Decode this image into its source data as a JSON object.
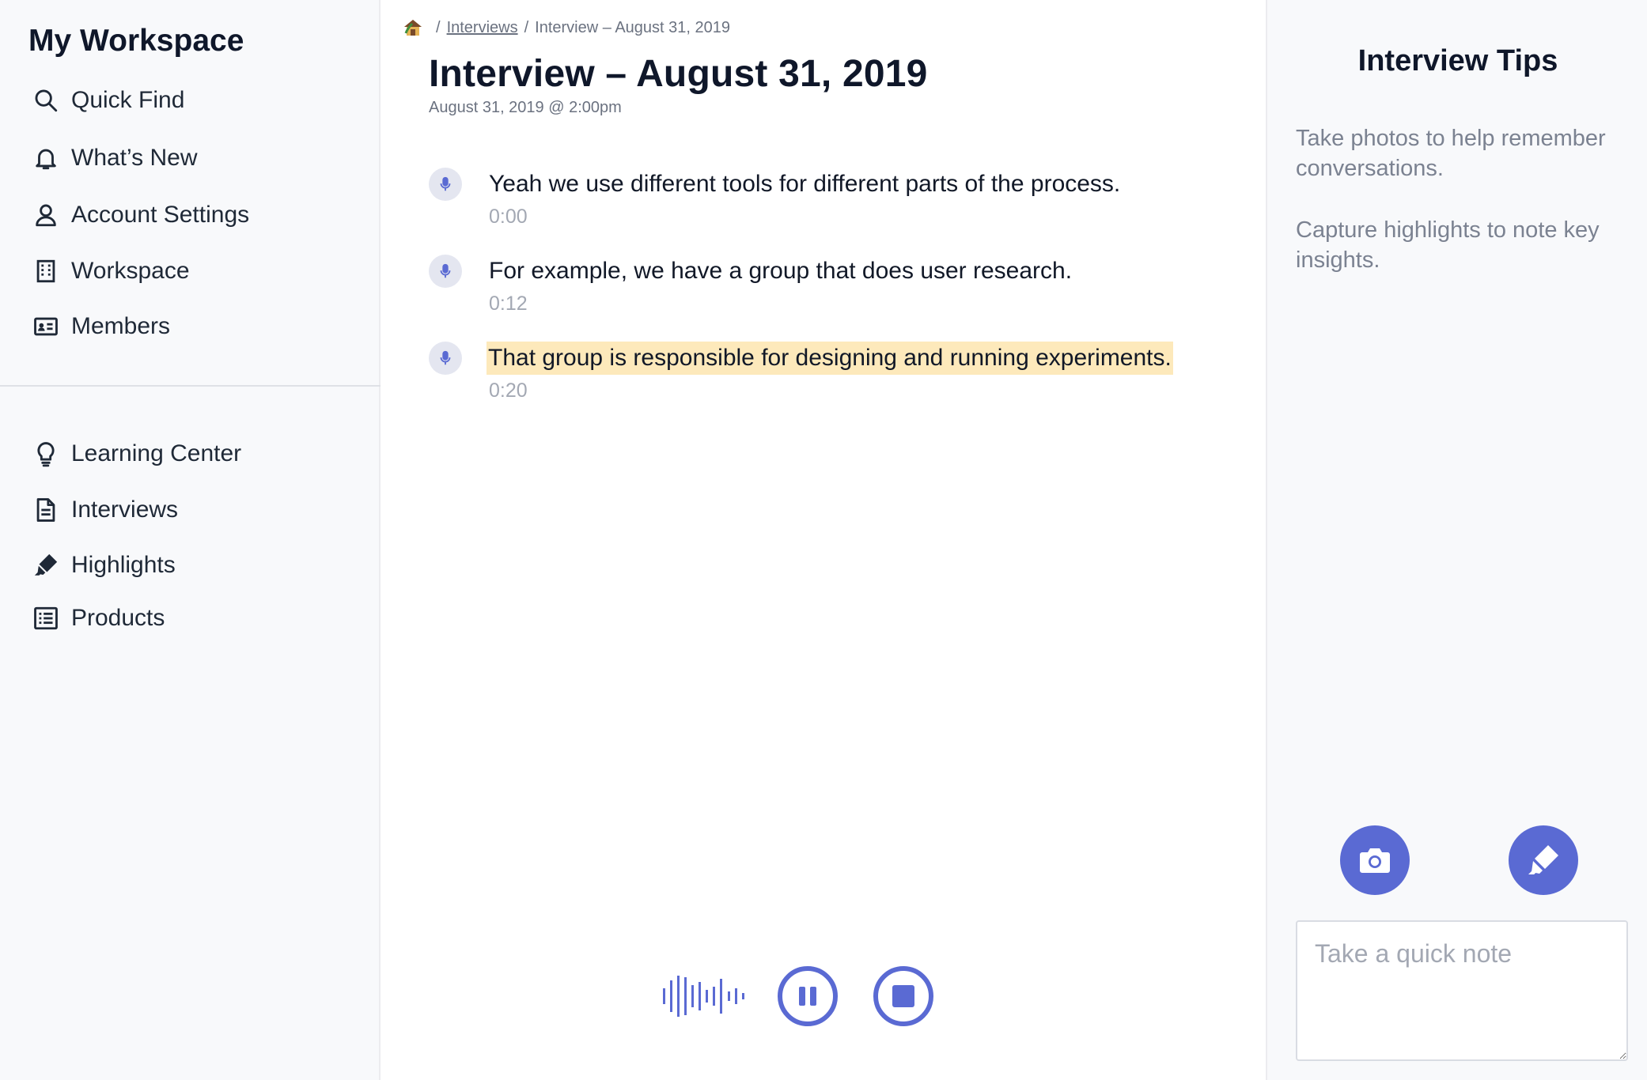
{
  "sidebar": {
    "title": "My Workspace",
    "top_items": [
      {
        "label": "Quick Find",
        "icon": "search-icon"
      },
      {
        "label": "What’s New",
        "icon": "bell-icon"
      },
      {
        "label": "Account Settings",
        "icon": "user-icon"
      },
      {
        "label": "Workspace",
        "icon": "building-icon"
      },
      {
        "label": "Members",
        "icon": "id-card-icon"
      }
    ],
    "bottom_items": [
      {
        "label": "Learning Center",
        "icon": "lightbulb-icon"
      },
      {
        "label": "Interviews",
        "icon": "document-icon"
      },
      {
        "label": "Highlights",
        "icon": "highlighter-icon"
      },
      {
        "label": "Products",
        "icon": "list-icon"
      }
    ]
  },
  "main": {
    "breadcrumb": {
      "home_icon": "home-icon",
      "sep": "/",
      "link": "Interviews",
      "current": "Interview – August 31, 2019"
    },
    "title": "Interview – August 31, 2019",
    "subtitle": "August 31, 2019 @ 2:00pm",
    "entries": [
      {
        "text": "Yeah we use different tools for different parts of the process.",
        "time": "0:00",
        "highlighted": false
      },
      {
        "text": "For example, we have a group that does user research.",
        "time": "0:12",
        "highlighted": false
      },
      {
        "text": "That group is responsible for designing and running experiments.",
        "time": "0:20",
        "highlighted": true
      }
    ],
    "controls": {
      "wave_icon": "audio-wave-icon",
      "pause_icon": "pause-icon",
      "stop_icon": "stop-icon"
    }
  },
  "right_panel": {
    "title": "Interview Tips",
    "tips": [
      "Take photos to help remember conversations.",
      "Capture highlights to note key insights."
    ],
    "camera_icon": "camera-icon",
    "marker_icon": "highlighter-icon",
    "note_placeholder": "Take a quick note",
    "note_value": ""
  },
  "colors": {
    "accent": "#5a6ad3",
    "highlight": "#fde9bb",
    "sidebar_bg": "#f8f9fb",
    "muted_text": "#6b7280"
  }
}
